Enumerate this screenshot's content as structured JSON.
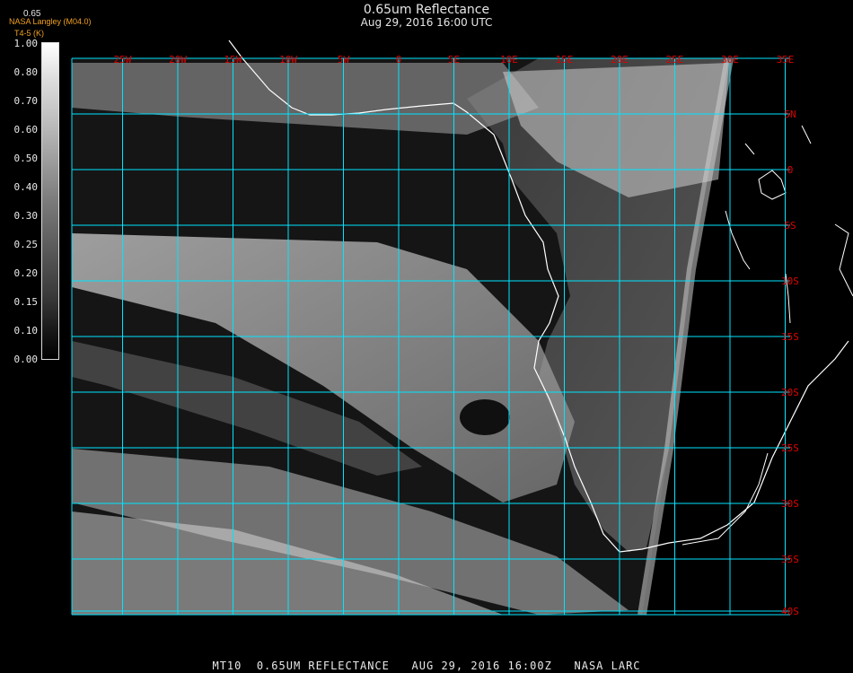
{
  "header": {
    "title": "0.65um Reflectance",
    "subtitle": "Aug 29, 2016 16:00 UTC"
  },
  "credit": {
    "line1": "NASA Langley (M04.0)",
    "line2": "T4-5 (K)"
  },
  "colorbar": {
    "label": "0.65",
    "ticks": [
      "1.00",
      "0.80",
      "0.70",
      "0.60",
      "0.50",
      "0.40",
      "0.30",
      "0.25",
      "0.20",
      "0.15",
      "0.10",
      "0.00"
    ]
  },
  "map": {
    "lon_labels": [
      "25W",
      "20W",
      "15W",
      "10W",
      "5W",
      "0",
      "5E",
      "10E",
      "15E",
      "20E",
      "25E",
      "30E",
      "35E"
    ],
    "lat_labels": [
      "5N",
      "0",
      "5S",
      "10S",
      "15S",
      "20S",
      "25S",
      "30S",
      "35S",
      "40S"
    ],
    "grid_color": "#00e5ff",
    "label_color": "#e00000",
    "coast_color": "#ffffff"
  },
  "footer": {
    "text": "MT10  0.65UM REFLECTANCE   AUG 29, 2016 16:00Z   NASA LARC"
  }
}
